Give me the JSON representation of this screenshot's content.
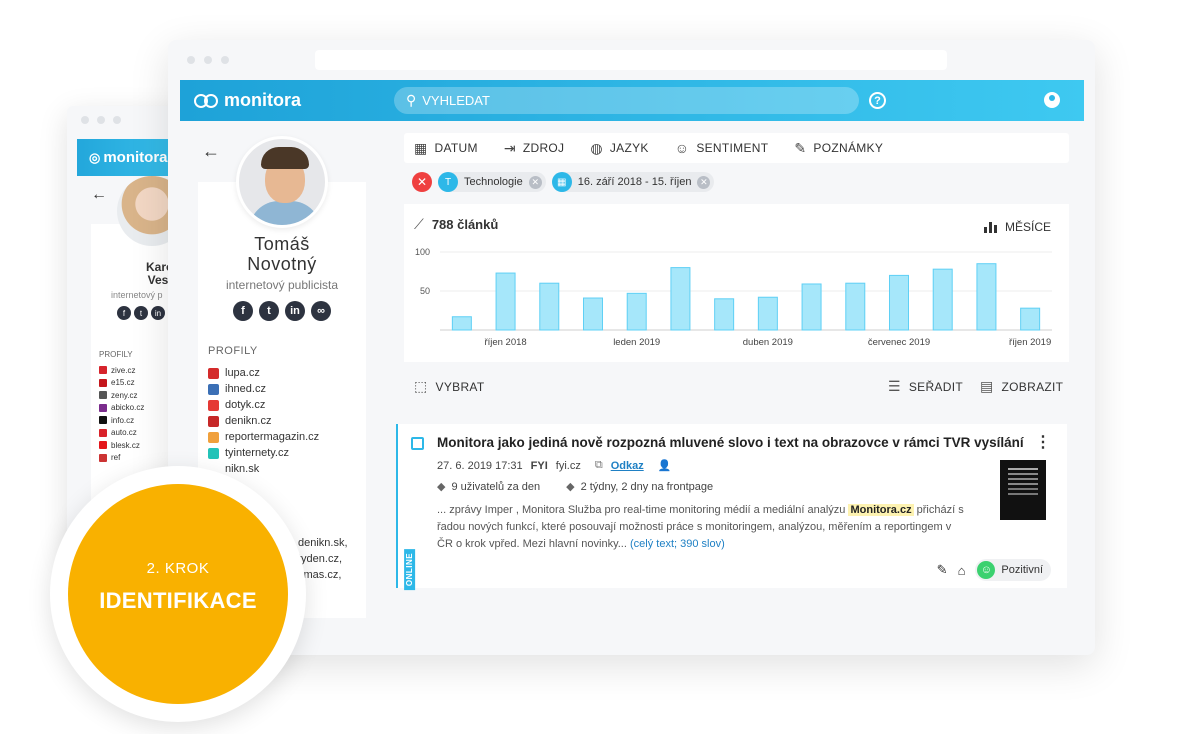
{
  "back_window": {
    "logo": "monitora",
    "person_name": "Karolí\nVesel",
    "person_role": "internetový p",
    "profiles_title": "PROFILY",
    "profiles": [
      {
        "name": "zive.cz",
        "color": "#d6242c"
      },
      {
        "name": "e15.cz",
        "color": "#c4161c"
      },
      {
        "name": "zeny.cz",
        "color": "#555555"
      },
      {
        "name": "abicko.cz",
        "color": "#7a2c8c"
      },
      {
        "name": "info.cz",
        "color": "#111111"
      },
      {
        "name": "auto.cz",
        "color": "#d9222a"
      },
      {
        "name": "blesk.cz",
        "color": "#e4161b"
      },
      {
        "name": "ref",
        "color": "#cc3333"
      }
    ]
  },
  "header": {
    "logo": "monitora",
    "search_placeholder": "VYHLEDAT",
    "help": "?"
  },
  "profile": {
    "name": "Tomáš\nNovotný",
    "role": "internetový publicista",
    "socials": [
      "f",
      "t",
      "in",
      "∞"
    ],
    "profiles_title": "PROFILY",
    "profiles": [
      {
        "name": "lupa.cz",
        "color": "#d42b2b"
      },
      {
        "name": "ihned.cz",
        "color": "#3b6fb5"
      },
      {
        "name": "dotyk.cz",
        "color": "#e53935"
      },
      {
        "name": "denikn.cz",
        "color": "#c62828"
      },
      {
        "name": "reportermagazin.cz",
        "color": "#f0a03c"
      },
      {
        "name": "tyinternety.cz",
        "color": "#23c3b8"
      },
      {
        "name": "nikn.sk",
        "color": "#ffffff"
      }
    ],
    "extra_profiles": [
      "denikn.sk,",
      "tyden.cz,",
      "smas.cz,",
      ","
    ]
  },
  "filters": {
    "items": [
      {
        "label": "DATUM",
        "icon": "calendar-icon"
      },
      {
        "label": "ZDROJ",
        "icon": "source-icon"
      },
      {
        "label": "JAZYK",
        "icon": "globe-icon"
      },
      {
        "label": "SENTIMENT",
        "icon": "smiley-icon"
      },
      {
        "label": "POZNÁMKY",
        "icon": "pencil-icon"
      }
    ],
    "chips": [
      {
        "badge": "T",
        "label": "Technologie"
      },
      {
        "badge": "▦",
        "label": "16. září 2018 - 15. říjen"
      }
    ]
  },
  "chart_data": {
    "type": "bar",
    "title": "788 článků",
    "period_button": "MĚSÍCE",
    "y_ticks": [
      100,
      50
    ],
    "ylim": [
      0,
      100
    ],
    "x_tick_labels": [
      "říjen 2018",
      "leden 2019",
      "duben 2019",
      "červenec 2019",
      "říjen 2019"
    ],
    "x_tick_index": [
      1.5,
      4.5,
      7.5,
      10.5,
      13.5
    ],
    "values": [
      17,
      73,
      60,
      41,
      47,
      80,
      40,
      42,
      59,
      60,
      70,
      78,
      85,
      28
    ],
    "color": "#a6e7fa",
    "stroke": "#5fd0f5"
  },
  "toolbar": {
    "select": "VYBRAT",
    "sort": "SEŘADIT",
    "view": "ZOBRAZIT"
  },
  "article": {
    "title": "Monitora jako jediná nově rozpozná mluvené slovo i text na obrazovce v rámci TVR vysílání",
    "date": "27. 6. 2019 17:31",
    "source_logo": "FYI",
    "source": "fyi.cz",
    "link": "Odkaz",
    "users": "9 uživatelů za den",
    "frontpage": "2 týdny, 2 dny na frontpage",
    "excerpt_before": "... zprávy Imper , Monitora Služba pro real-time monitoring médií a mediální analýzu",
    "excerpt_mark": "Monitora.cz",
    "excerpt_after": "přichází s řadou nových funkcí, které posouvají možnosti práce s monitoringem, analýzou, měřením a reportingem v ČR o krok vpřed. Mezi hlavní novinky...",
    "more": "(celý text; 390 slov)",
    "channel": "ONLINE",
    "sentiment": "Pozitivní"
  },
  "step": {
    "line1": "2. KROK",
    "line2": "IDENTIFIKACE",
    "color": "#f9b100"
  }
}
